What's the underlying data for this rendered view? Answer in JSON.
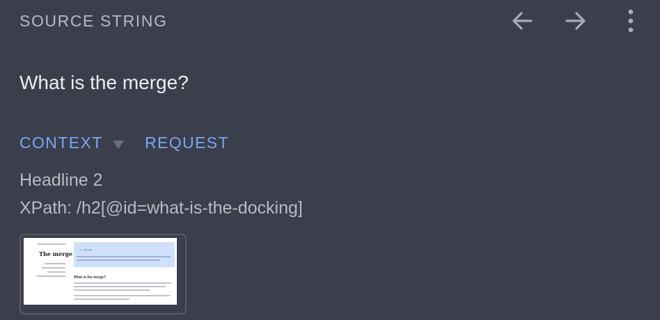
{
  "header": {
    "section_title": "SOURCE STRING",
    "back_icon": "arrow-left-icon",
    "forward_icon": "arrow-right-icon",
    "more_icon": "more-vertical-icon"
  },
  "source": {
    "text": "What is the merge?"
  },
  "tabs": {
    "context_label": "CONTEXT",
    "request_label": "REQUEST"
  },
  "context": {
    "element_type": "Headline 2",
    "xpath": "XPath: /h2[@id=what-is-the-docking]"
  },
  "screenshot": {
    "page_title": "The merge",
    "section_heading": "What is the merge?"
  },
  "colors": {
    "background": "#3a3f4b",
    "accent": "#7aa6f3",
    "muted_text": "#b7bbc3"
  }
}
